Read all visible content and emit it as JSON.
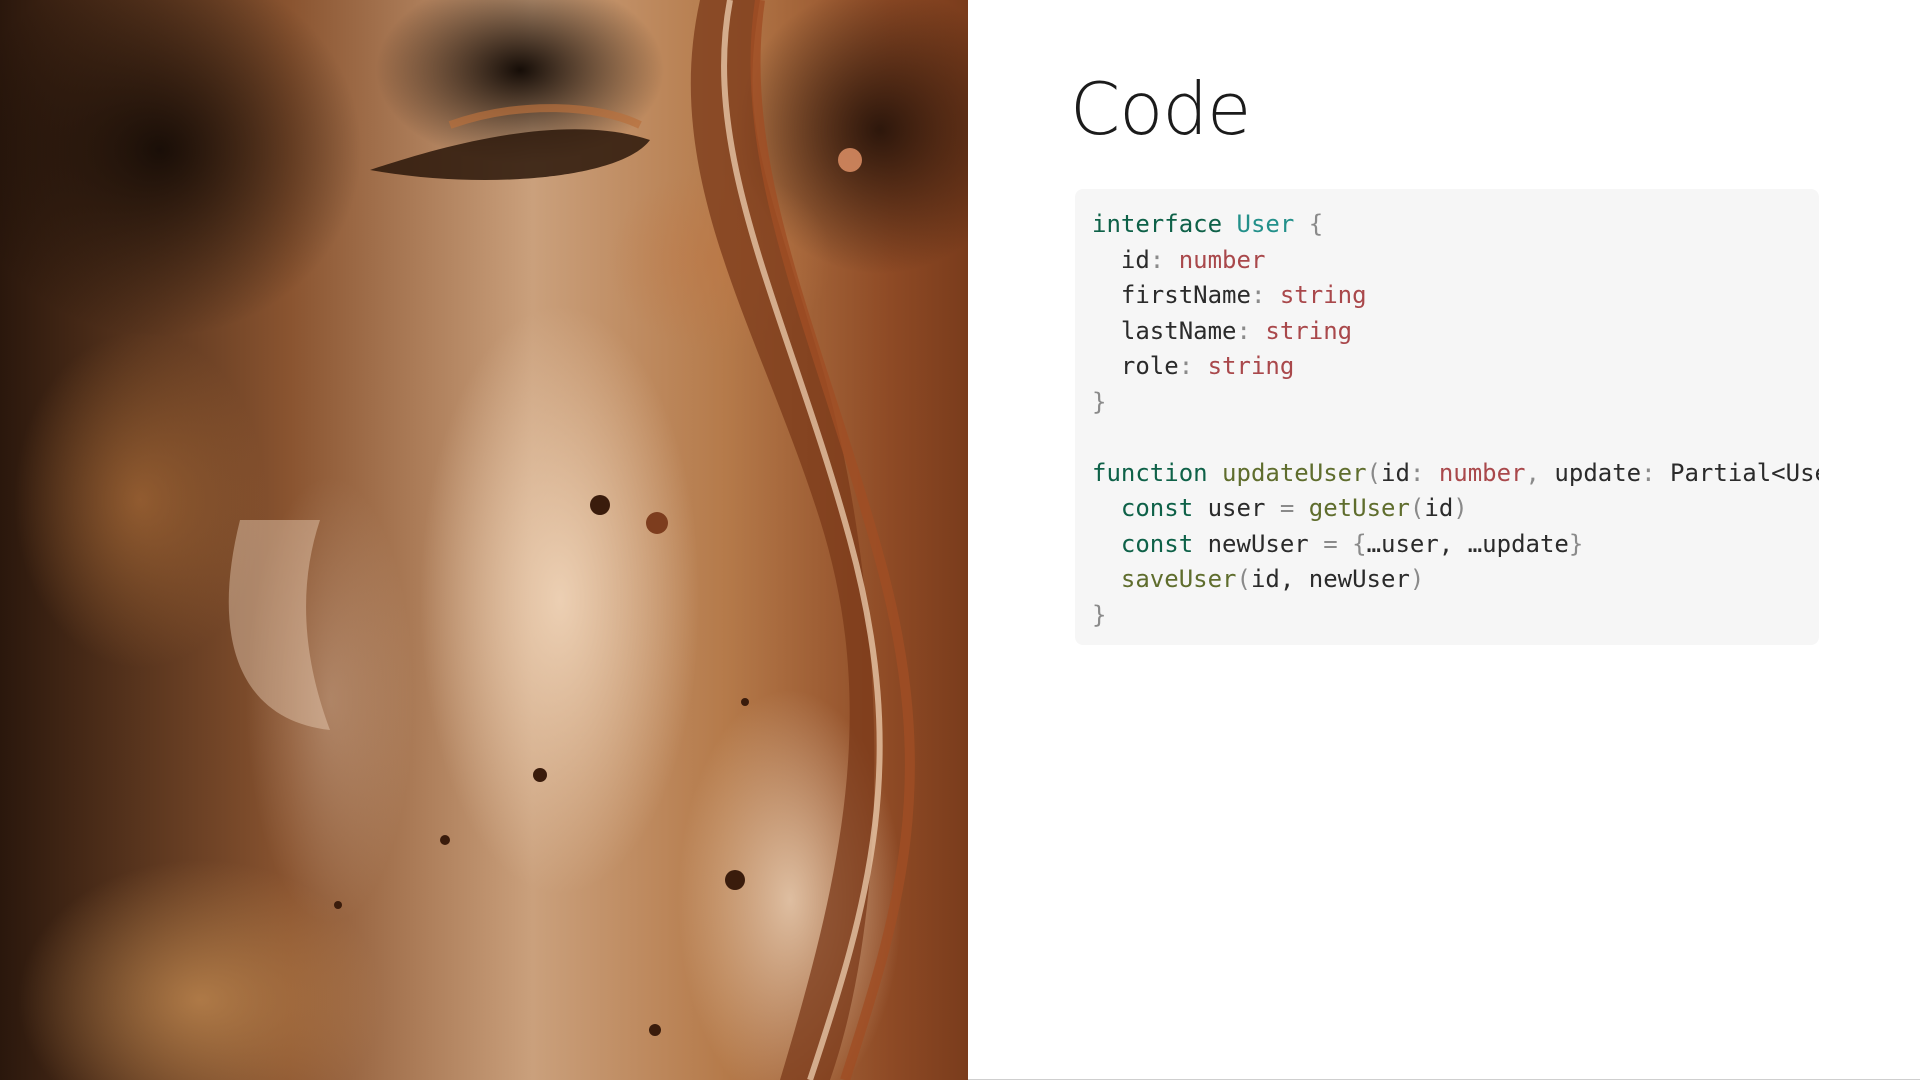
{
  "slide": {
    "title": "Code",
    "code": {
      "language": "typescript",
      "lines": [
        [
          {
            "t": "interface",
            "c": "kw"
          },
          {
            "t": " ",
            "c": "id"
          },
          {
            "t": "User",
            "c": "ty"
          },
          {
            "t": " {",
            "c": "pu"
          }
        ],
        [
          {
            "t": "  id",
            "c": "id"
          },
          {
            "t": ": ",
            "c": "pu"
          },
          {
            "t": "number",
            "c": "tp"
          }
        ],
        [
          {
            "t": "  firstName",
            "c": "id"
          },
          {
            "t": ": ",
            "c": "pu"
          },
          {
            "t": "string",
            "c": "tp"
          }
        ],
        [
          {
            "t": "  lastName",
            "c": "id"
          },
          {
            "t": ": ",
            "c": "pu"
          },
          {
            "t": "string",
            "c": "tp"
          }
        ],
        [
          {
            "t": "  role",
            "c": "id"
          },
          {
            "t": ": ",
            "c": "pu"
          },
          {
            "t": "string",
            "c": "tp"
          }
        ],
        [
          {
            "t": "}",
            "c": "pu"
          }
        ],
        [],
        [
          {
            "t": "function",
            "c": "kw"
          },
          {
            "t": " ",
            "c": "id"
          },
          {
            "t": "updateUser",
            "c": "fn"
          },
          {
            "t": "(",
            "c": "pu"
          },
          {
            "t": "id",
            "c": "id"
          },
          {
            "t": ": ",
            "c": "pu"
          },
          {
            "t": "number",
            "c": "tp"
          },
          {
            "t": ", ",
            "c": "pu"
          },
          {
            "t": "update",
            "c": "id"
          },
          {
            "t": ": ",
            "c": "pu"
          },
          {
            "t": "Partial<User>) {",
            "c": "id"
          }
        ],
        [
          {
            "t": "  ",
            "c": "id"
          },
          {
            "t": "const",
            "c": "kw"
          },
          {
            "t": " user ",
            "c": "id"
          },
          {
            "t": "= ",
            "c": "pu"
          },
          {
            "t": "getUser",
            "c": "fn"
          },
          {
            "t": "(",
            "c": "pu"
          },
          {
            "t": "id",
            "c": "id"
          },
          {
            "t": ")",
            "c": "pu"
          }
        ],
        [
          {
            "t": "  ",
            "c": "id"
          },
          {
            "t": "const",
            "c": "kw"
          },
          {
            "t": " newUser ",
            "c": "id"
          },
          {
            "t": "= {",
            "c": "pu"
          },
          {
            "t": "…user, ",
            "c": "id"
          },
          {
            "t": "…update",
            "c": "id"
          },
          {
            "t": "}",
            "c": "pu"
          }
        ],
        [
          {
            "t": "  ",
            "c": "id"
          },
          {
            "t": "saveUser",
            "c": "fn"
          },
          {
            "t": "(",
            "c": "pu"
          },
          {
            "t": "id, newUser",
            "c": "id"
          },
          {
            "t": ")",
            "c": "pu"
          }
        ],
        [
          {
            "t": "}",
            "c": "pu"
          }
        ]
      ]
    }
  },
  "colors": {
    "background": "#ffffff",
    "code_background": "#f6f6f6",
    "keyword": "#0e6148",
    "type_name": "#23908a",
    "primitive_type": "#a9484b",
    "function_name": "#5f6d2d",
    "punctuation": "#8a8a8a",
    "identifier": "#2b2b2b",
    "image_accent": "#a0572c"
  }
}
